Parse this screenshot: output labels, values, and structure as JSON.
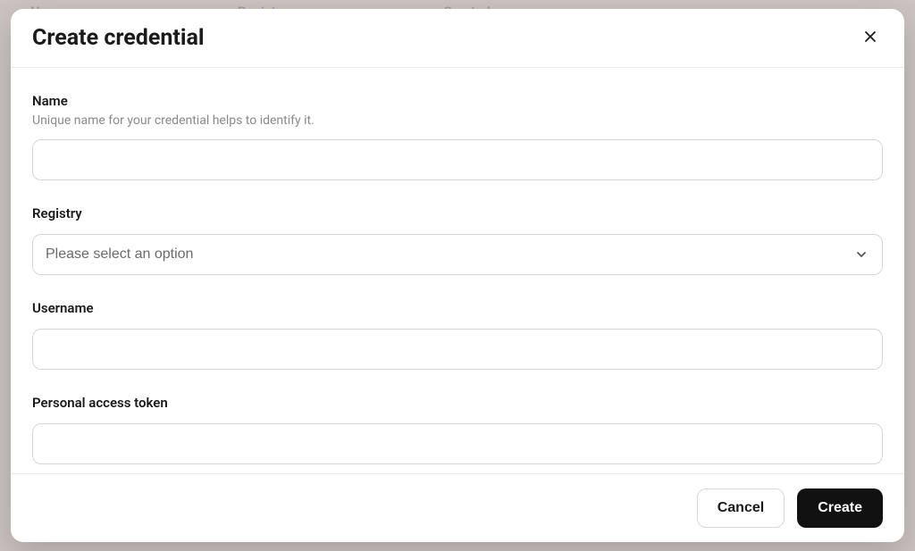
{
  "background_table": {
    "columns": [
      "Name",
      "Registry",
      "Created"
    ]
  },
  "modal": {
    "title": "Create credential",
    "fields": {
      "name": {
        "label": "Name",
        "hint": "Unique name for your credential helps to identify it.",
        "value": ""
      },
      "registry": {
        "label": "Registry",
        "placeholder": "Please select an option",
        "selected": ""
      },
      "username": {
        "label": "Username",
        "value": ""
      },
      "token": {
        "label": "Personal access token",
        "value": ""
      }
    },
    "buttons": {
      "cancel": "Cancel",
      "create": "Create"
    }
  }
}
